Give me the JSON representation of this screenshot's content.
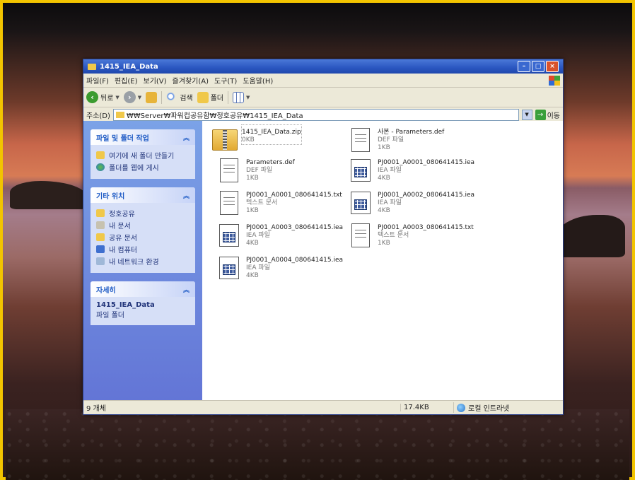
{
  "window": {
    "title": "1415_IEA_Data"
  },
  "menu": [
    "파일(F)",
    "편집(E)",
    "보기(V)",
    "즐겨찾기(A)",
    "도구(T)",
    "도움말(H)"
  ],
  "toolbar": {
    "back_label": "뒤로",
    "search_label": "검색",
    "folders_label": "폴더"
  },
  "address": {
    "label": "주소(D)",
    "path": "₩₩Server₩파워컵공유함₩정호공유₩1415_IEA_Data",
    "go_label": "이동"
  },
  "sidebar": {
    "tasks": {
      "title": "파일 및 폴더 작업",
      "items": [
        "여기에 새 폴더 만들기",
        "폴더를 웹에 게시"
      ]
    },
    "places": {
      "title": "기타 위치",
      "items": [
        "정호공유",
        "내 문서",
        "공유 문서",
        "내 컴퓨터",
        "내 네트워크 환경"
      ]
    },
    "details": {
      "title": "자세히",
      "name": "1415_IEA_Data",
      "type": "파일 폴더"
    }
  },
  "files": [
    {
      "name": "1415_IEA_Data.zip",
      "type": "",
      "size": "0KB",
      "icon": "zip-icon"
    },
    {
      "name": "사본 - Parameters.def",
      "type": "DEF 파일",
      "size": "1KB",
      "icon": "document-icon"
    },
    {
      "name": "Parameters.def",
      "type": "DEF 파일",
      "size": "1KB",
      "icon": "document-icon"
    },
    {
      "name": "PJ0001_A0001_080641415.iea",
      "type": "IEA 파일",
      "size": "4KB",
      "icon": "iea-file-icon"
    },
    {
      "name": "PJ0001_A0001_080641415.txt",
      "type": "텍스트 문서",
      "size": "1KB",
      "icon": "text-file-icon"
    },
    {
      "name": "PJ0001_A0002_080641415.iea",
      "type": "IEA 파일",
      "size": "4KB",
      "icon": "iea-file-icon"
    },
    {
      "name": "PJ0001_A0003_080641415.iea",
      "type": "IEA 파일",
      "size": "4KB",
      "icon": "iea-file-icon"
    },
    {
      "name": "PJ0001_A0003_080641415.txt",
      "type": "텍스트 문서",
      "size": "1KB",
      "icon": "text-file-icon"
    },
    {
      "name": "PJ0001_A0004_080641415.iea",
      "type": "IEA 파일",
      "size": "4KB",
      "icon": "iea-file-icon"
    }
  ],
  "status": {
    "count": "9 개체",
    "size": "17.4KB",
    "zone": "로컬 인트라넷"
  },
  "colors": {
    "titlebar": "#2a56c0",
    "taskpane": "#6f8fe0",
    "frame": "#f2c400"
  }
}
